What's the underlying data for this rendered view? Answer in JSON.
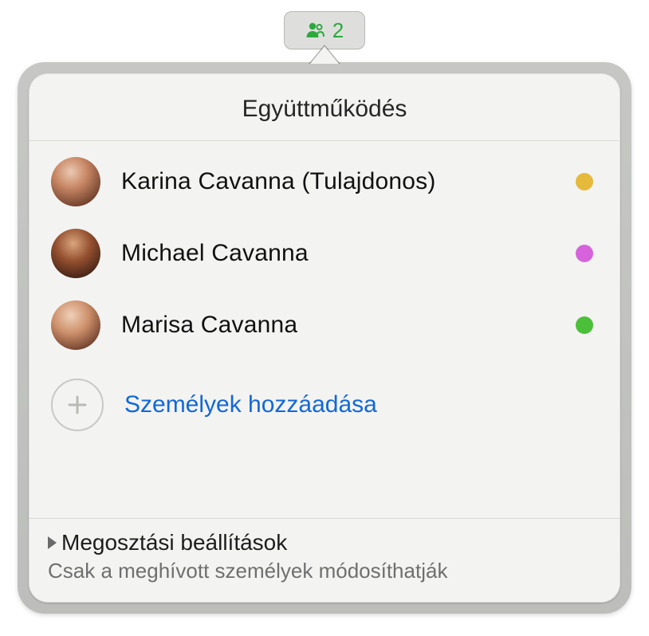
{
  "pill": {
    "count": "2"
  },
  "title": "Együttműködés",
  "participants": [
    {
      "name": "Karina Cavanna (Tulajdonos)",
      "color": "#e5b93b"
    },
    {
      "name": "Michael Cavanna",
      "color": "#d763dc"
    },
    {
      "name": "Marisa Cavanna",
      "color": "#4cbf3a"
    }
  ],
  "add_label": "Személyek hozzáadása",
  "footer": {
    "title": "Megosztási beállítások",
    "subtitle": "Csak a meghívott személyek módosíthatják"
  }
}
